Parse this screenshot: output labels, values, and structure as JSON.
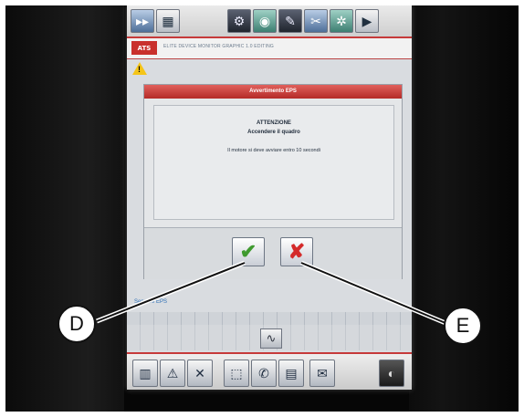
{
  "header": {
    "logo": "ATS",
    "text": "ELITE DEVICE MONITOR GRAPHIC 1.0 EDITING"
  },
  "dialog": {
    "title": "Avvertimento EPS",
    "line1": "ATTENZIONE",
    "line2": "Accendere il quadro",
    "line3": "Il motore si deve avviare entro 10 secondi"
  },
  "status": {
    "label": "Sensore EPS"
  },
  "buttons": {
    "ok": "✔",
    "cancel": "✘",
    "tilde": "∿"
  },
  "callouts": {
    "left": "D",
    "right": "E"
  },
  "colors": {
    "accent_red": "#c63a3a",
    "ok_green": "#3f9a2f",
    "cancel_red": "#d42a2a"
  }
}
